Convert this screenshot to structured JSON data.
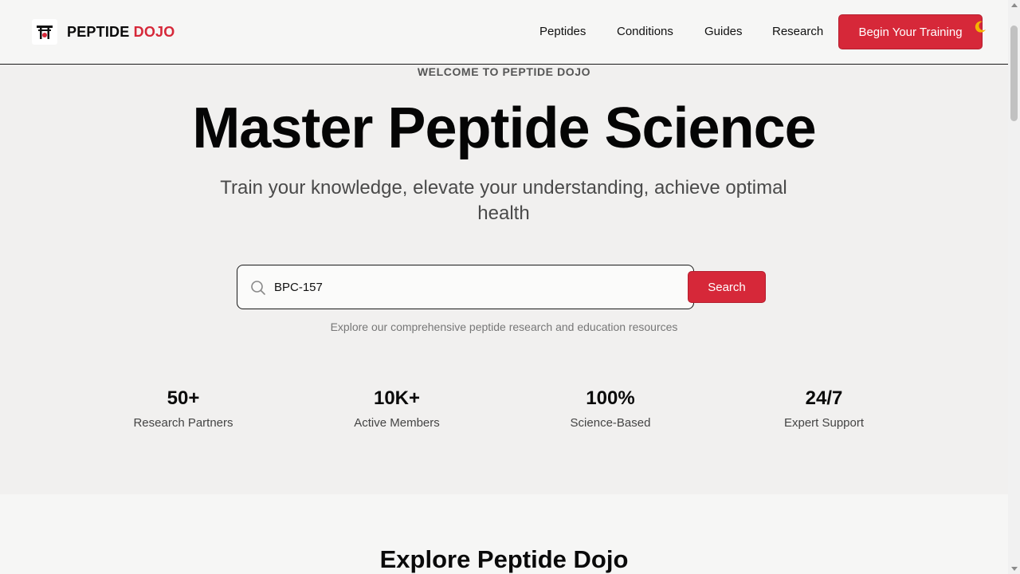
{
  "brand": {
    "name_primary": "PEPTIDE",
    "name_accent": "DOJO",
    "accent_color": "#d62839"
  },
  "nav": {
    "items": [
      {
        "label": "Peptides"
      },
      {
        "label": "Conditions"
      },
      {
        "label": "Guides"
      },
      {
        "label": "Research"
      }
    ],
    "cta_label": "Begin Your Training",
    "theme_icon": "moon-icon"
  },
  "hero": {
    "eyebrow": "WELCOME TO PEPTIDE DOJO",
    "title": "Master Peptide Science",
    "subtitle": "Train your knowledge, elevate your understanding, achieve optimal health"
  },
  "search": {
    "value": "BPC-157",
    "button_label": "Search",
    "helper_text": "Explore our comprehensive peptide research and education resources"
  },
  "stats": [
    {
      "value": "50+",
      "label": "Research Partners"
    },
    {
      "value": "10K+",
      "label": "Active Members"
    },
    {
      "value": "100%",
      "label": "Science-Based"
    },
    {
      "value": "24/7",
      "label": "Expert Support"
    }
  ],
  "section": {
    "title": "Explore Peptide Dojo"
  }
}
